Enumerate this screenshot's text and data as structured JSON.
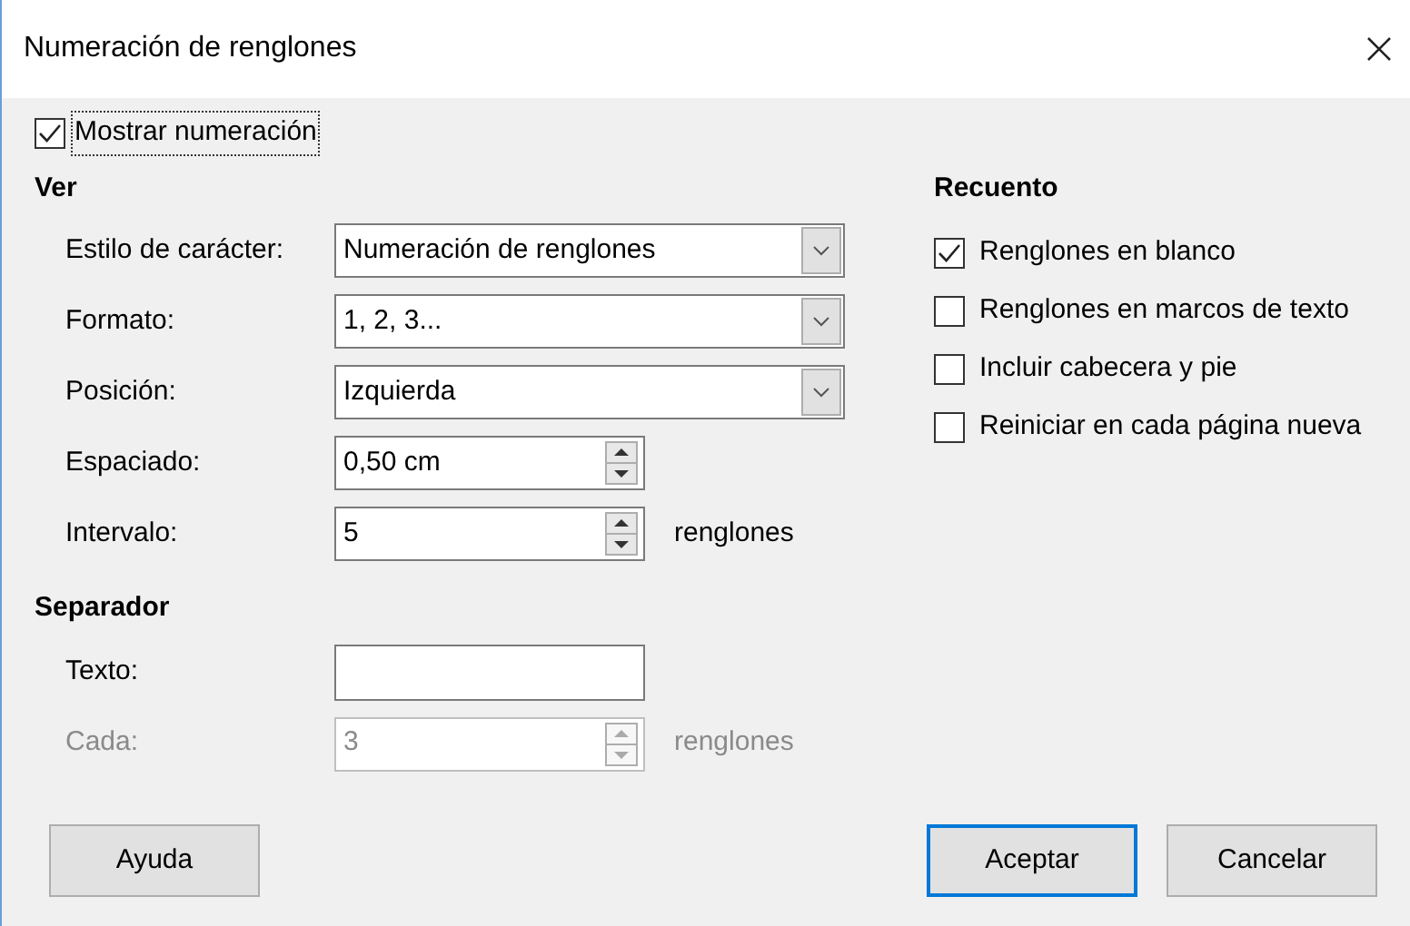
{
  "window": {
    "title": "Numeración de renglones"
  },
  "show_numbering": {
    "label": "Mostrar numeración",
    "checked": true,
    "focused": true
  },
  "view": {
    "heading": "Ver",
    "fields": [
      {
        "kind": "dropdown",
        "label": "Estilo de carácter:",
        "value": "Numeración de renglones",
        "disabled": false
      },
      {
        "kind": "dropdown",
        "label": "Formato:",
        "value": "1, 2, 3...",
        "disabled": false
      },
      {
        "kind": "dropdown",
        "label": "Posición:",
        "value": "Izquierda",
        "disabled": false
      },
      {
        "kind": "spin",
        "label": "Espaciado:",
        "value": "0,50 cm",
        "disabled": false
      },
      {
        "kind": "spin",
        "label": "Intervalo:",
        "value": "5",
        "unit": "renglones",
        "disabled": false
      }
    ]
  },
  "separator": {
    "heading": "Separador",
    "fields": [
      {
        "kind": "text",
        "label": "Texto:",
        "disabled": false
      },
      {
        "kind": "spin",
        "label": "Cada:",
        "value": "3",
        "unit": "renglones",
        "disabled": true
      }
    ]
  },
  "count": {
    "heading": "Recuento",
    "options": [
      {
        "label": "Renglones en blanco",
        "checked": true
      },
      {
        "label": "Renglones en marcos de texto",
        "checked": false
      },
      {
        "label": "Incluir cabecera y pie",
        "checked": false
      },
      {
        "label": "Reiniciar en cada página nueva",
        "checked": false
      }
    ]
  },
  "help_button": {
    "label": "Ayuda"
  },
  "buttons": [
    {
      "label": "Aceptar",
      "default": true
    },
    {
      "label": "Cancelar",
      "default": false
    }
  ]
}
